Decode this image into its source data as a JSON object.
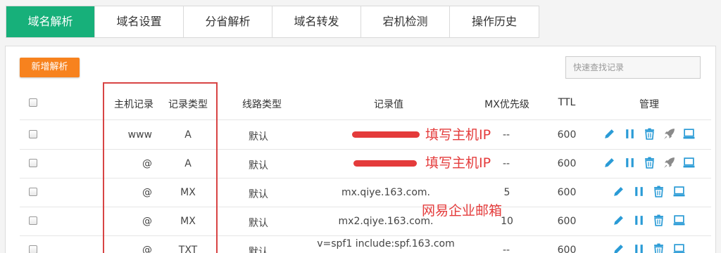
{
  "tabs": [
    "域名解析",
    "域名设置",
    "分省解析",
    "域名转发",
    "宕机检测",
    "操作历史"
  ],
  "toolbar": {
    "add_label": "新增解析"
  },
  "search": {
    "placeholder": "快速查找记录"
  },
  "table": {
    "headers": {
      "host": "主机记录",
      "type": "记录类型",
      "line": "线路类型",
      "value": "记录值",
      "mx": "MX优先级",
      "ttl": "TTL",
      "manage": "管理"
    },
    "rows": [
      {
        "host": "www",
        "type": "A",
        "line": "默认",
        "value": "",
        "mx": "--",
        "ttl": "600"
      },
      {
        "host": "@",
        "type": "A",
        "line": "默认",
        "value": "",
        "mx": "--",
        "ttl": "600"
      },
      {
        "host": "@",
        "type": "MX",
        "line": "默认",
        "value": "mx.qiye.163.com.",
        "mx": "5",
        "ttl": "600"
      },
      {
        "host": "@",
        "type": "MX",
        "line": "默认",
        "value": "mx2.qiye.163.com.",
        "mx": "10",
        "ttl": "600"
      },
      {
        "host": "@",
        "type": "TXT",
        "line": "默认",
        "value": "v=spf1 include:spf.163.com",
        "mx": "--",
        "ttl": "600"
      }
    ]
  },
  "annotations": {
    "fill_host_ip": "填写主机IP",
    "netease_mail": "网易企业邮箱"
  },
  "colors": {
    "accent": "#17b07a",
    "add_button": "#f7821e",
    "icon_blue": "#2a9bd6",
    "annotation_red": "#e43b3b",
    "disabled_icon": "#8a8a8a"
  },
  "icons": {
    "edit": "pencil-icon",
    "pause": "pause-icon",
    "delete": "trash-icon",
    "rocket": "rocket-icon",
    "monitor": "monitor-icon"
  }
}
